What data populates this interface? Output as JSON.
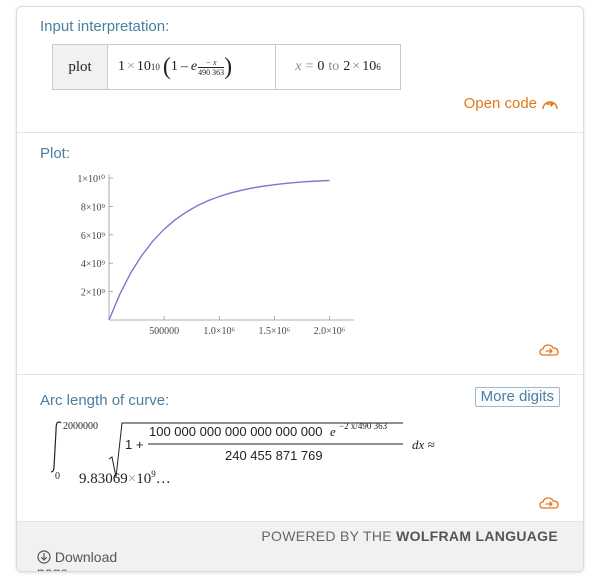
{
  "input_interpretation": {
    "title": "Input interpretation:",
    "head": "plot",
    "coefficient": "1",
    "times": "×",
    "power_base": "10",
    "power_exp": "10",
    "one": "1",
    "minus": "–",
    "e": "e",
    "exp_sign": "−",
    "exp_num": "x",
    "exp_den": "490 363",
    "range_var": "x",
    "range_eq": "=",
    "range_from": "0",
    "range_to_word": "to",
    "range_to_coef": "2",
    "range_to_base": "10",
    "range_to_exp": "6",
    "open_code": "Open code"
  },
  "plot": {
    "title": "Plot:"
  },
  "chart_data": {
    "type": "line",
    "function": "1×10^10 (1 − e^(−x/490363))",
    "x_range": [
      0,
      2000000
    ],
    "y_range": [
      0,
      10000000000
    ],
    "series": [
      {
        "values": [
          [
            0,
            0
          ],
          [
            100000,
            1845000000
          ],
          [
            200000,
            3350000000
          ],
          [
            300000,
            4574000000
          ],
          [
            400000,
            5577000000
          ],
          [
            500000,
            6393000000
          ],
          [
            600000,
            7059000000
          ],
          [
            700000,
            7602000000
          ],
          [
            800000,
            8044000000
          ],
          [
            900000,
            8405000000
          ],
          [
            1000000,
            8699000000
          ],
          [
            1100000,
            8939000000
          ],
          [
            1200000,
            9134000000
          ],
          [
            1300000,
            9294000000
          ],
          [
            1400000,
            9424000000
          ],
          [
            1500000,
            9530000000
          ],
          [
            1600000,
            9617000000
          ],
          [
            1700000,
            9688000000
          ],
          [
            1800000,
            9745000000
          ],
          [
            1900000,
            9792000000
          ],
          [
            2000000,
            9831000000
          ]
        ]
      }
    ],
    "x_ticks": [
      "500000",
      "1.0×10⁶",
      "1.5×10⁶",
      "2.0×10⁶"
    ],
    "x_tick_values": [
      500000,
      1000000,
      1500000,
      2000000
    ],
    "y_ticks": [
      "1×10¹⁰",
      "8×10⁹",
      "6×10⁹",
      "4×10⁹",
      "2×10⁹"
    ],
    "y_tick_values": [
      10000000000,
      8000000000,
      6000000000,
      4000000000,
      2000000000
    ],
    "line_color": "#7a77c9",
    "grid": false
  },
  "arc_length": {
    "title": "Arc length of curve:",
    "more_digits": "More digits",
    "upper_limit": "2000000",
    "lower_limit": "0",
    "one_plus": "1 +",
    "numerator": "100 000 000 000 000 000 000",
    "num_e": "e",
    "num_exp": "−2 x/490 363",
    "denominator": "240 455 871 769",
    "dx": "dx ≈",
    "value_mantissa": "9.83069",
    "value_times": "×",
    "value_base": "10",
    "value_exp": "9",
    "value_ellipsis": "…"
  },
  "footer": {
    "powered_prefix": "POWERED BY THE",
    "powered_brand": "WOLFRAM LANGUAGE",
    "download_label": "Download page"
  },
  "colors": {
    "pod_title": "#4b7ea0",
    "open_code": "#e2771c",
    "curve": "#7a77c9",
    "icon_orange": "#e2771c"
  },
  "icons": {
    "open_code_icon": "open-code-arrow-icon",
    "refresh_icon": "cloud-arrow-icon",
    "download_icon": "circle-down-arrow-icon"
  }
}
